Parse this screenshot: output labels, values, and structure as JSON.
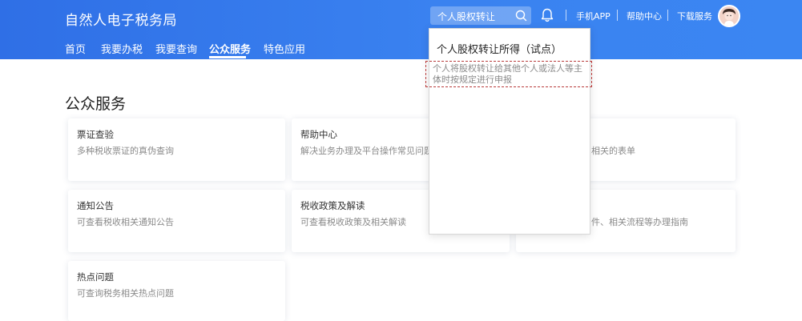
{
  "header": {
    "brand": "自然人电子税务局",
    "search_value": "个人股权转让",
    "links": [
      "手机APP",
      "帮助中心",
      "下载服务"
    ]
  },
  "nav": {
    "items": [
      "首页",
      "我要办税",
      "我要查询",
      "公众服务",
      "特色应用"
    ],
    "active": "公众服务"
  },
  "page_title": "公众服务",
  "cards": [
    {
      "title": "票证查验",
      "desc": "多种税收票证的真伪查询"
    },
    {
      "title": "帮助中心",
      "desc": "解决业务办理及平台操作常见问题"
    },
    {
      "title": "",
      "desc": "相关的表单"
    },
    {
      "title": "通知公告",
      "desc": "可查看税收相关通知公告"
    },
    {
      "title": "税收政策及解读",
      "desc": "可查看税收政策及相关解读"
    },
    {
      "title": "",
      "desc": "件、相关流程等办理指南"
    },
    {
      "title": "热点问题",
      "desc": "可查询税务相关热点问题"
    }
  ],
  "dropdown": {
    "header": "个人股权转让所得（试点）",
    "result_desc": "个人将股权转让给其他个人或法人等主体时按规定进行申报"
  },
  "colors": {
    "header_bg": "#3078ec",
    "accent": "#b83a3a"
  }
}
